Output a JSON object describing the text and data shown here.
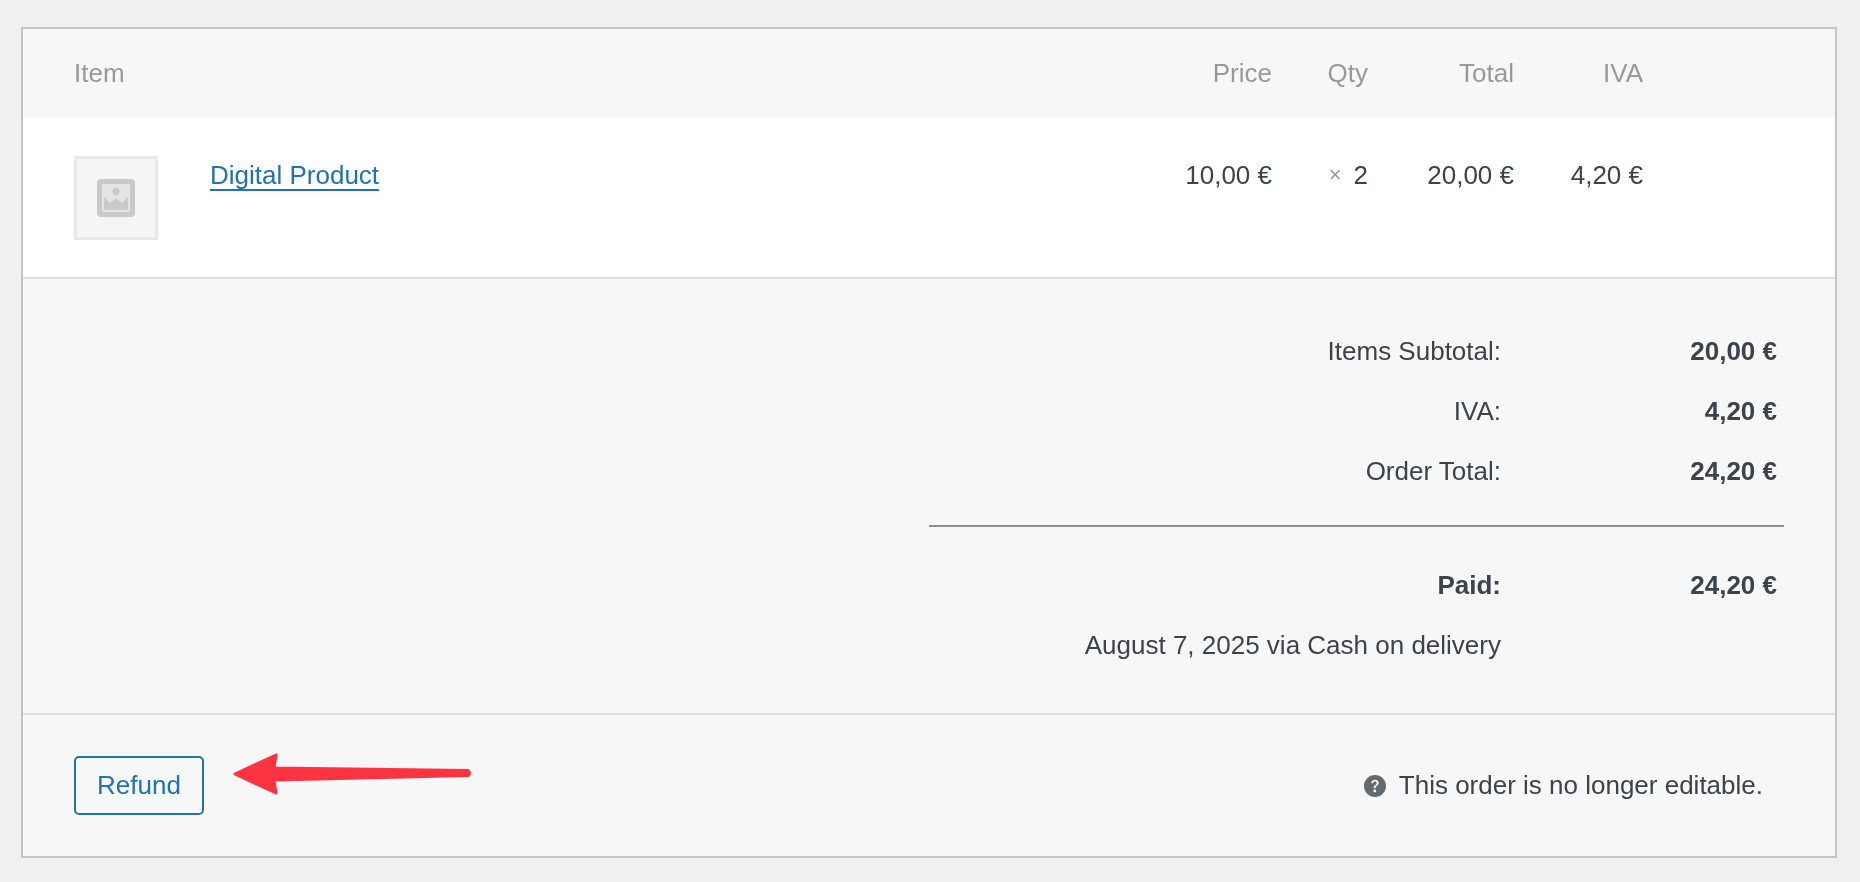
{
  "table": {
    "columns": [
      "Item",
      "Price",
      "Qty",
      "Total",
      "IVA"
    ],
    "rows": [
      {
        "name": "Digital Product",
        "price": "10,00 €",
        "qty_sign": "×",
        "qty": "2",
        "total": "20,00 €",
        "tax": "4,20 €"
      }
    ]
  },
  "totals": [
    {
      "label": "Items Subtotal:",
      "value": "20,00 €"
    },
    {
      "label": "IVA:",
      "value": "4,20 €"
    },
    {
      "label": "Order Total:",
      "value": "24,20 €"
    }
  ],
  "payment": {
    "label": "Paid:",
    "value": "24,20 €",
    "note": "August 7, 2025 via Cash on delivery"
  },
  "actions": {
    "refund_button": "Refund",
    "notice": "This order is no longer editable."
  }
}
